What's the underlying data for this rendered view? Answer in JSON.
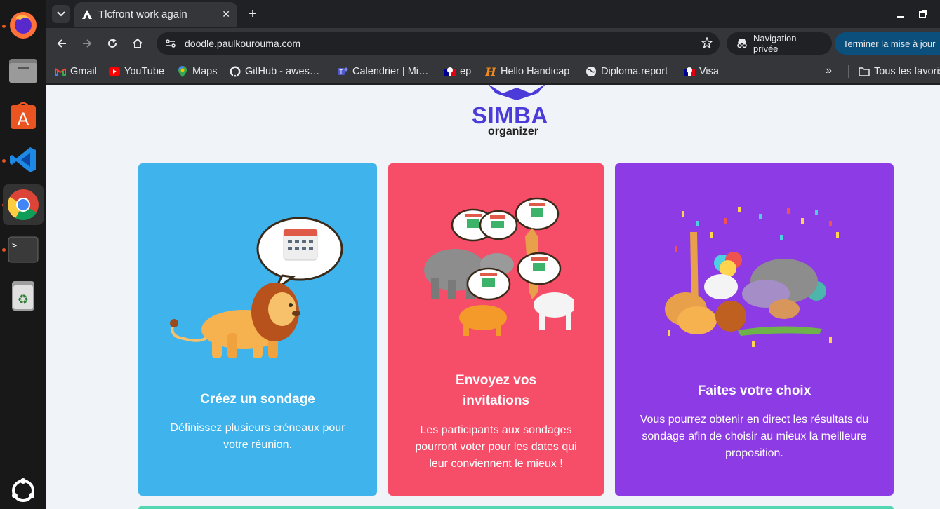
{
  "browser": {
    "tab_title": "Tlcfront work again",
    "url": "doodle.paulkourouma.com",
    "incognito_label": "Navigation privée",
    "update_label": "Terminer la mise à jour",
    "bookmarks": [
      {
        "label": "Gmail",
        "icon": "gmail-icon"
      },
      {
        "label": "YouTube",
        "icon": "youtube-icon"
      },
      {
        "label": "Maps",
        "icon": "maps-icon"
      },
      {
        "label": "GitHub - awes…",
        "icon": "github-icon"
      },
      {
        "label": "Calendrier | Mi…",
        "icon": "teams-icon"
      },
      {
        "label": "ep",
        "icon": "marianne-icon"
      },
      {
        "label": "Hello Handicap",
        "icon": "hello-handicap-icon"
      },
      {
        "label": "Diploma.report",
        "icon": "globe-icon"
      },
      {
        "label": "Visa",
        "icon": "marianne-icon"
      }
    ],
    "all_bookmarks_label": "Tous les favoris"
  },
  "page": {
    "logo": {
      "brand": "SIMBA",
      "sub": "organizer"
    },
    "cards": [
      {
        "title": "Créez un sondage",
        "text": "Définissez plusieurs créneaux pour votre réunion."
      },
      {
        "title_line1": "Envoyez vos",
        "title_line2": "invitations",
        "text": "Les participants aux sondages pourront voter pour les dates qui leur conviennent le mieux !"
      },
      {
        "title": "Faites votre choix",
        "text": "Vous pourrez obtenir en direct les résultats du sondage afin de choisir au mieux la meilleure proposition."
      }
    ]
  },
  "colors": {
    "card_blue": "#3fb3ec",
    "card_red": "#f64d69",
    "card_purple": "#8d3be4",
    "logo": "#4b3bd9",
    "bottom_bar": "#53d6b1"
  }
}
